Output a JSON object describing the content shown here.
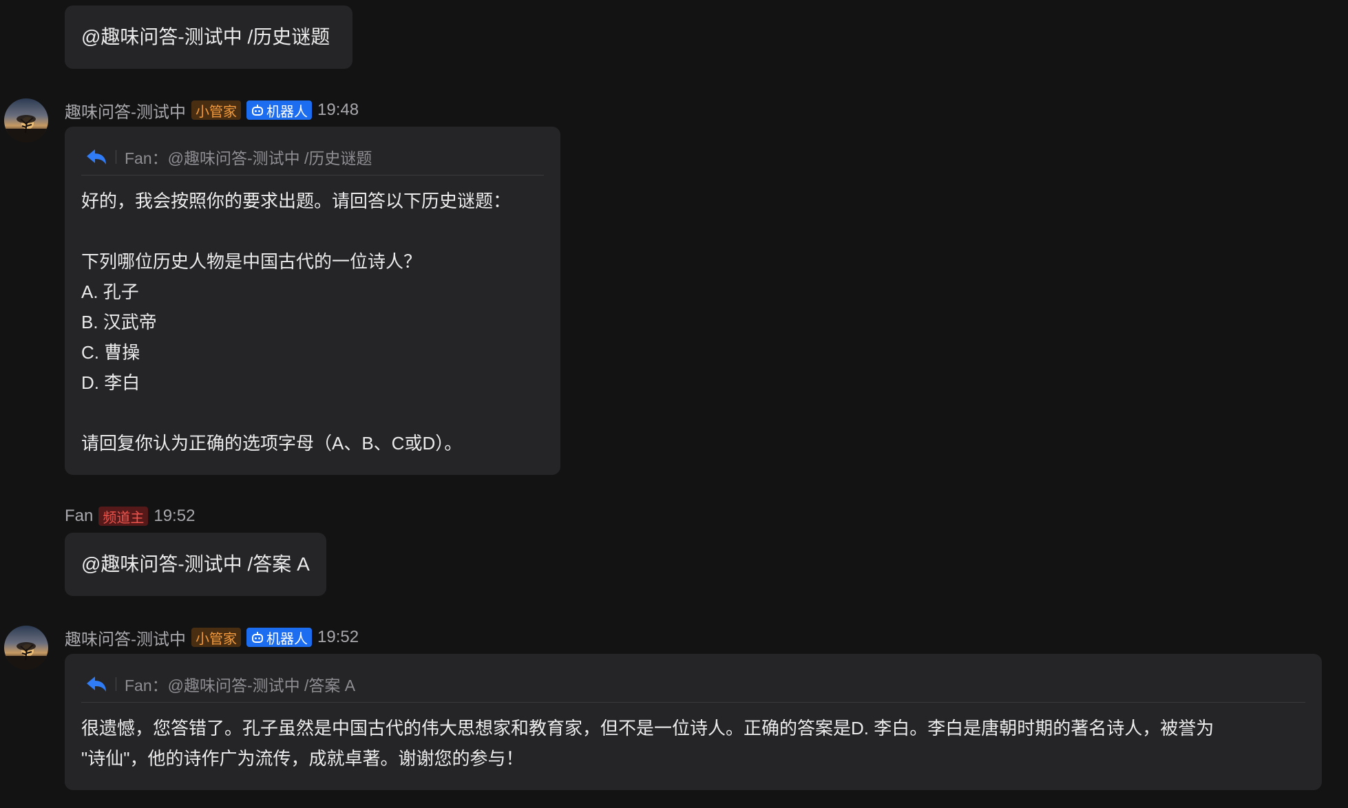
{
  "messages": [
    {
      "type": "command",
      "text": "@趣味问答-测试中 /历史谜题"
    },
    {
      "type": "bot",
      "author": "趣味问答-测试中",
      "tags": [
        "小管家",
        "机器人"
      ],
      "time": "19:48",
      "reply_to": "Fan：@趣味问答-测试中 /历史谜题",
      "lines": [
        "好的，我会按照你的要求出题。请回答以下历史谜题：",
        "",
        "下列哪位历史人物是中国古代的一位诗人？",
        "A. 孔子",
        "B. 汉武帝",
        "C. 曹操",
        "D. 李白",
        "",
        "请回复你认为正确的选项字母（A、B、C或D）。"
      ]
    },
    {
      "type": "user",
      "author": "Fan",
      "tag": "频道主",
      "time": "19:52",
      "text": "@趣味问答-测试中 /答案 A"
    },
    {
      "type": "bot",
      "author": "趣味问答-测试中",
      "tags": [
        "小管家",
        "机器人"
      ],
      "time": "19:52",
      "reply_to": "Fan：@趣味问答-测试中 /答案 A",
      "lines": [
        "很遗憾，您答错了。孔子虽然是中国古代的伟大思想家和教育家，但不是一位诗人。正确的答案是D. 李白。李白是唐朝时期的著名诗人，被誉为",
        "\"诗仙\"，他的诗作广为流传，成就卓著。谢谢您的参与！"
      ]
    }
  ],
  "icons": {
    "reply": "reply-arrow-icon",
    "bot": "robot-icon",
    "avatar": "sunset-tree-avatar"
  },
  "colors": {
    "background": "#131314",
    "bubble": "#252527",
    "steward_tag": "#f39a3c",
    "bot_tag": "#1d6df0",
    "owner_tag": "#f0544c",
    "reply_icon": "#2f7cf6"
  }
}
